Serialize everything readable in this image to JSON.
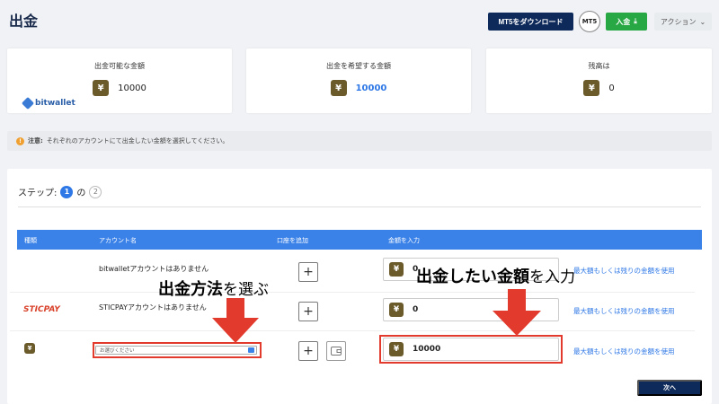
{
  "page": {
    "title": "出金"
  },
  "header": {
    "mt5_download": "MT5をダウンロード",
    "mt5_badge": "MT5",
    "deposit": "入金",
    "deposit_icon": "download-icon",
    "action": "アクション",
    "action_icon": "chevron-down-icon"
  },
  "cards": {
    "available": {
      "label": "出金可能な金額",
      "value": "10000"
    },
    "desired": {
      "label": "出金を希望する金額",
      "value": "10000"
    },
    "balance": {
      "label": "残高は",
      "value": "0"
    },
    "currency_symbol": "¥"
  },
  "notice": {
    "bold": "注意:",
    "text": "それぞれのアカウントにて出金したい金額を選択してください。"
  },
  "steps": {
    "label": "ステップ:",
    "current": "1",
    "of": "の",
    "total": "2"
  },
  "table": {
    "headers": [
      "種類",
      "アカウント名",
      "口座を追加",
      "金額を入力"
    ],
    "rows": [
      {
        "type": "bitwallet",
        "account": "bitwalletアカウントはありません",
        "amount": "0",
        "max_link": "最大額もしくは残りの金額を使用"
      },
      {
        "type": "STICPAY",
        "account": "STICPAYアカウントはありません",
        "amount": "0",
        "max_link": "最大額もしくは残りの金額を使用"
      },
      {
        "type": "¥",
        "select_placeholder": "お選びください",
        "amount": "10000",
        "max_link": "最大額もしくは残りの金額を使用"
      }
    ]
  },
  "next_button": "次へ",
  "annotations": {
    "left_bold": "出金方法",
    "left_rest": "を選ぶ",
    "right_bold": "出金したい金額",
    "right_rest": "を入力"
  },
  "colors": {
    "navy": "#0e2a5a",
    "green": "#28a745",
    "blue": "#3b82e8",
    "red": "#e23b2e",
    "yen": "#6b5a2a"
  }
}
